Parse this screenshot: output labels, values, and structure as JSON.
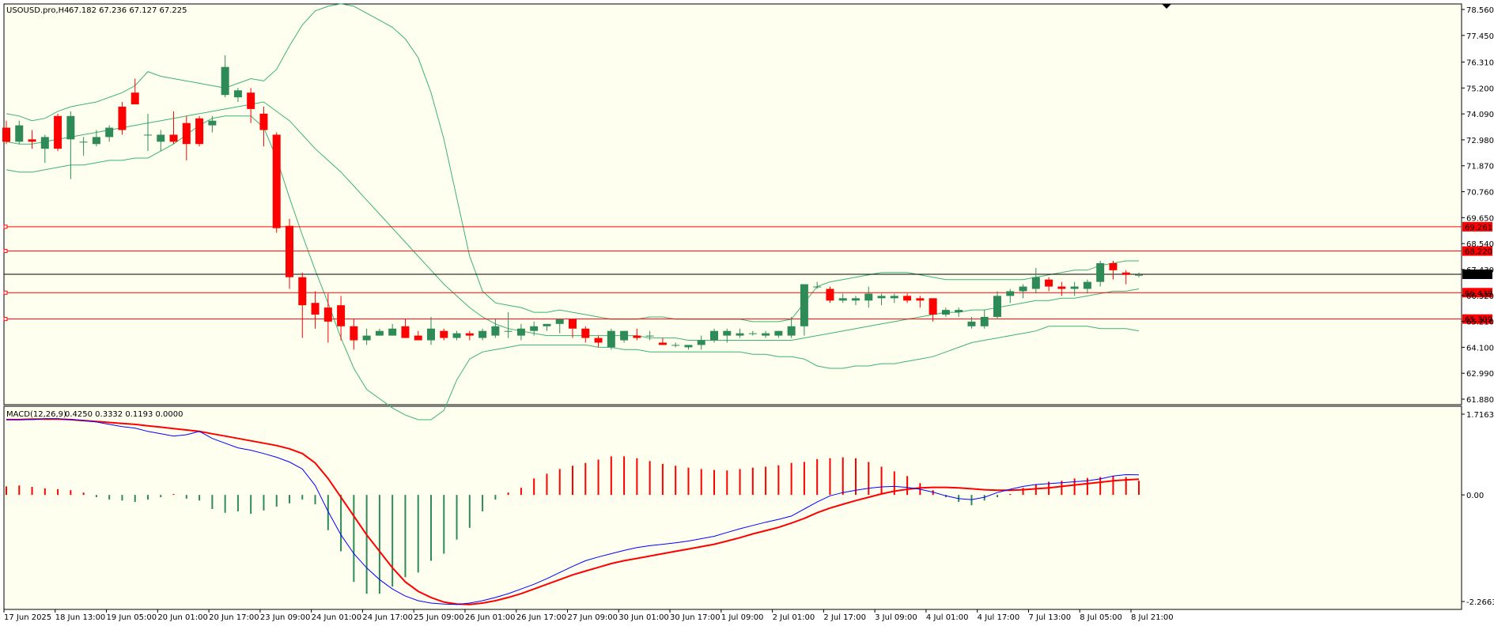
{
  "header": {
    "symbol": "USOUSD.pro,H4",
    "ohlc": "67.182 67.236 67.127 67.225"
  },
  "indicator": {
    "label": "MACD(12,26,9)",
    "values": "0.4250 0.3332 0.1193 0.0000"
  },
  "colors": {
    "background": "#fffff0",
    "bull": "#2e8b57",
    "bear": "#ff0000",
    "bands": "#3cb371",
    "macd_line": "#0000ff",
    "signal_line": "#ff0000",
    "level": "#ff0000",
    "price_line": "#000000"
  },
  "price_axis": {
    "ticks": [
      "78.560",
      "77.450",
      "76.310",
      "75.200",
      "74.090",
      "72.980",
      "71.870",
      "70.760",
      "69.650",
      "68.540",
      "67.430",
      "66.320",
      "65.210",
      "64.100",
      "62.990",
      "61.880"
    ],
    "range": [
      61.88,
      78.56
    ]
  },
  "macd_axis": {
    "ticks": [
      "1.7163",
      "0.00",
      "-2.2663"
    ],
    "range": [
      -2.2663,
      1.7163
    ]
  },
  "time_axis": {
    "labels": [
      "17 Jun 2025",
      "18 Jun 13:00",
      "19 Jun 05:00",
      "20 Jun 01:00",
      "20 Jun 17:00",
      "23 Jun 09:00",
      "24 Jun 01:00",
      "24 Jun 17:00",
      "25 Jun 09:00",
      "26 Jun 01:00",
      "26 Jun 17:00",
      "27 Jun 09:00",
      "30 Jun 01:00",
      "30 Jun 17:00",
      "1 Jul 09:00",
      "2 Jul 01:00",
      "2 Jul 17:00",
      "3 Jul 09:00",
      "4 Jul 01:00",
      "4 Jul 17:00",
      "7 Jul 13:00",
      "8 Jul 05:00",
      "8 Jul 21:00"
    ]
  },
  "levels": [
    {
      "value": 69.261,
      "label": "69.261"
    },
    {
      "value": 68.22,
      "label": "68.220"
    },
    {
      "value": 66.439,
      "label": "66.439"
    },
    {
      "value": 65.309,
      "label": "65.309"
    }
  ],
  "current_price": {
    "value": 67.225,
    "label": "67.225"
  },
  "chart_data": {
    "type": "candlestick",
    "title": "USOUSD.pro,H4",
    "candles": [
      [
        73.5,
        73.8,
        72.8,
        72.9
      ],
      [
        72.9,
        73.8,
        72.8,
        73.6
      ],
      [
        73.0,
        73.4,
        72.6,
        72.9
      ],
      [
        72.6,
        73.2,
        72.0,
        73.1
      ],
      [
        74.0,
        74.1,
        72.5,
        72.6
      ],
      [
        73.0,
        74.2,
        71.3,
        74.0
      ],
      [
        72.9,
        73.1,
        72.3,
        72.9
      ],
      [
        72.8,
        73.4,
        72.7,
        73.1
      ],
      [
        73.1,
        73.6,
        72.9,
        73.5
      ],
      [
        74.4,
        74.6,
        73.2,
        73.4
      ],
      [
        75.0,
        75.6,
        74.6,
        74.5
      ],
      [
        73.2,
        74.1,
        72.5,
        73.2
      ],
      [
        72.9,
        73.4,
        72.5,
        73.2
      ],
      [
        73.2,
        74.2,
        72.8,
        72.9
      ],
      [
        73.7,
        74.0,
        72.1,
        72.8
      ],
      [
        73.9,
        74.0,
        72.7,
        72.8
      ],
      [
        73.6,
        74.0,
        73.3,
        73.8
      ],
      [
        74.9,
        76.6,
        74.8,
        76.1
      ],
      [
        74.8,
        75.2,
        74.6,
        75.1
      ],
      [
        75.0,
        75.2,
        73.7,
        74.3
      ],
      [
        74.1,
        74.4,
        72.7,
        73.4
      ],
      [
        73.2,
        73.3,
        69.0,
        69.2
      ],
      [
        69.3,
        69.6,
        66.6,
        67.1
      ],
      [
        67.1,
        67.3,
        64.5,
        65.9
      ],
      [
        66.0,
        66.5,
        64.9,
        65.5
      ],
      [
        65.8,
        66.4,
        64.3,
        65.2
      ],
      [
        65.9,
        66.3,
        64.4,
        65.0
      ],
      [
        65.0,
        65.3,
        64.0,
        64.4
      ],
      [
        64.4,
        64.9,
        64.2,
        64.6
      ],
      [
        64.6,
        64.9,
        64.6,
        64.8
      ],
      [
        64.6,
        65.1,
        64.6,
        64.9
      ],
      [
        65.0,
        65.3,
        64.5,
        64.5
      ],
      [
        64.6,
        64.8,
        64.4,
        64.4
      ],
      [
        64.4,
        65.4,
        64.2,
        64.9
      ],
      [
        64.8,
        64.9,
        64.4,
        64.5
      ],
      [
        64.5,
        64.8,
        64.4,
        64.7
      ],
      [
        64.7,
        64.8,
        64.4,
        64.6
      ],
      [
        64.5,
        64.9,
        64.4,
        64.8
      ],
      [
        64.6,
        65.3,
        64.5,
        65.0
      ],
      [
        64.8,
        65.6,
        64.5,
        64.8
      ],
      [
        64.6,
        65.1,
        64.4,
        64.9
      ],
      [
        64.8,
        65.2,
        64.6,
        65.0
      ],
      [
        65.0,
        65.1,
        64.8,
        65.1
      ],
      [
        65.1,
        65.3,
        64.7,
        65.3
      ],
      [
        65.3,
        65.3,
        64.5,
        64.9
      ],
      [
        64.9,
        65.0,
        64.3,
        64.5
      ],
      [
        64.5,
        64.6,
        64.1,
        64.3
      ],
      [
        64.1,
        64.9,
        64.0,
        64.8
      ],
      [
        64.4,
        64.8,
        64.3,
        64.8
      ],
      [
        64.6,
        64.9,
        64.4,
        64.5
      ],
      [
        64.6,
        64.8,
        64.4,
        64.6
      ],
      [
        64.3,
        64.5,
        64.2,
        64.2
      ],
      [
        64.2,
        64.3,
        64.1,
        64.2
      ],
      [
        64.1,
        64.2,
        64.0,
        64.2
      ],
      [
        64.2,
        64.6,
        64.0,
        64.4
      ],
      [
        64.4,
        64.9,
        64.3,
        64.8
      ],
      [
        64.6,
        64.9,
        64.3,
        64.8
      ],
      [
        64.6,
        64.9,
        64.5,
        64.7
      ],
      [
        64.7,
        64.8,
        64.6,
        64.7
      ],
      [
        64.6,
        64.8,
        64.5,
        64.7
      ],
      [
        64.6,
        64.8,
        64.5,
        64.8
      ],
      [
        64.6,
        65.4,
        64.5,
        65.0
      ],
      [
        65.0,
        66.8,
        64.6,
        66.8
      ],
      [
        66.7,
        66.9,
        66.6,
        66.7
      ],
      [
        66.6,
        66.7,
        66.0,
        66.1
      ],
      [
        66.1,
        66.4,
        66.0,
        66.2
      ],
      [
        66.1,
        66.3,
        65.9,
        66.2
      ],
      [
        66.1,
        66.7,
        65.8,
        66.4
      ],
      [
        66.2,
        66.4,
        65.9,
        66.3
      ],
      [
        66.2,
        66.4,
        66.0,
        66.3
      ],
      [
        66.3,
        66.4,
        66.0,
        66.1
      ],
      [
        66.2,
        66.3,
        65.8,
        66.1
      ],
      [
        66.2,
        66.2,
        65.2,
        65.5
      ],
      [
        65.5,
        65.8,
        65.4,
        65.7
      ],
      [
        65.6,
        65.8,
        65.4,
        65.7
      ],
      [
        65.0,
        65.4,
        64.9,
        65.2
      ],
      [
        65.0,
        65.7,
        64.9,
        65.4
      ],
      [
        65.4,
        66.5,
        65.3,
        66.3
      ],
      [
        66.3,
        66.6,
        66.0,
        66.5
      ],
      [
        66.5,
        66.8,
        66.2,
        66.7
      ],
      [
        66.6,
        67.5,
        66.4,
        67.1
      ],
      [
        67.0,
        67.1,
        66.5,
        66.7
      ],
      [
        66.7,
        66.9,
        66.3,
        66.6
      ],
      [
        66.6,
        66.9,
        66.3,
        66.7
      ],
      [
        66.6,
        67.0,
        66.4,
        66.9
      ],
      [
        66.9,
        67.8,
        66.7,
        67.7
      ],
      [
        67.7,
        67.8,
        67.0,
        67.4
      ],
      [
        67.3,
        67.4,
        66.8,
        67.2
      ],
      [
        67.2,
        67.3,
        67.1,
        67.2
      ]
    ],
    "bollinger": {
      "upper": [
        74.1,
        74.0,
        73.8,
        73.9,
        74.2,
        74.4,
        74.5,
        74.6,
        74.8,
        75.0,
        75.3,
        75.9,
        75.7,
        75.6,
        75.5,
        75.4,
        75.3,
        75.2,
        75.4,
        75.6,
        75.5,
        76.0,
        77.0,
        77.9,
        78.5,
        78.7,
        78.8,
        78.7,
        78.4,
        78.1,
        77.8,
        77.3,
        76.5,
        75.0,
        73.0,
        70.5,
        68.0,
        66.5,
        66.0,
        65.9,
        65.8,
        65.6,
        65.6,
        65.7,
        65.6,
        65.5,
        65.4,
        65.3,
        65.3,
        65.3,
        65.4,
        65.4,
        65.3,
        65.3,
        65.3,
        65.3,
        65.3,
        65.3,
        65.2,
        65.2,
        65.2,
        65.3,
        66.0,
        66.7,
        66.9,
        67.0,
        67.1,
        67.2,
        67.3,
        67.3,
        67.3,
        67.2,
        67.1,
        67.0,
        67.0,
        67.0,
        67.0,
        67.0,
        67.0,
        67.0,
        67.1,
        67.2,
        67.3,
        67.4,
        67.4,
        67.6,
        67.7,
        67.8,
        67.8
      ],
      "middle": [
        72.9,
        72.8,
        72.8,
        72.9,
        73.0,
        73.1,
        73.2,
        73.3,
        73.4,
        73.5,
        73.6,
        73.7,
        73.8,
        73.9,
        74.0,
        74.1,
        74.2,
        74.3,
        74.4,
        74.5,
        74.6,
        74.2,
        73.8,
        73.2,
        72.6,
        72.1,
        71.6,
        71.0,
        70.4,
        69.8,
        69.2,
        68.6,
        68.0,
        67.4,
        66.8,
        66.3,
        65.8,
        65.4,
        65.1,
        64.9,
        64.8,
        64.7,
        64.6,
        64.6,
        64.6,
        64.6,
        64.6,
        64.6,
        64.6,
        64.6,
        64.5,
        64.5,
        64.5,
        64.4,
        64.4,
        64.4,
        64.4,
        64.4,
        64.4,
        64.4,
        64.4,
        64.4,
        64.5,
        64.6,
        64.7,
        64.8,
        64.9,
        65.0,
        65.1,
        65.2,
        65.3,
        65.4,
        65.5,
        65.6,
        65.6,
        65.7,
        65.7,
        65.8,
        65.9,
        66.0,
        66.1,
        66.1,
        66.2,
        66.2,
        66.3,
        66.4,
        66.5,
        66.5,
        66.6
      ],
      "lower": [
        71.7,
        71.6,
        71.6,
        71.7,
        71.8,
        71.9,
        71.9,
        72.0,
        72.1,
        72.1,
        72.2,
        72.2,
        72.5,
        72.8,
        73.2,
        73.6,
        73.9,
        74.0,
        74.0,
        74.0,
        73.5,
        72.2,
        70.5,
        68.9,
        67.4,
        66.0,
        64.5,
        63.2,
        62.3,
        61.9,
        61.5,
        61.2,
        61.0,
        61.0,
        61.4,
        62.7,
        63.6,
        63.9,
        64.0,
        64.1,
        64.2,
        64.2,
        64.2,
        64.2,
        64.2,
        64.2,
        64.1,
        64.1,
        64.0,
        64.0,
        63.9,
        63.9,
        63.9,
        63.9,
        63.9,
        63.9,
        63.9,
        63.9,
        63.8,
        63.8,
        63.7,
        63.7,
        63.6,
        63.3,
        63.2,
        63.2,
        63.3,
        63.3,
        63.4,
        63.4,
        63.5,
        63.6,
        63.7,
        63.9,
        64.1,
        64.3,
        64.4,
        64.5,
        64.6,
        64.7,
        64.8,
        65.0,
        65.0,
        65.0,
        65.0,
        64.9,
        64.9,
        64.9,
        64.8
      ]
    },
    "macd": {
      "histogram": [
        0.18,
        0.2,
        0.17,
        0.14,
        0.12,
        0.1,
        0.05,
        -0.05,
        -0.1,
        -0.12,
        -0.15,
        -0.1,
        -0.05,
        0.02,
        -0.08,
        -0.12,
        -0.3,
        -0.38,
        -0.35,
        -0.4,
        -0.33,
        -0.25,
        -0.18,
        -0.1,
        -0.2,
        -0.75,
        -1.2,
        -1.85,
        -2.1,
        -2.1,
        -1.95,
        -1.75,
        -1.65,
        -1.4,
        -1.25,
        -0.95,
        -0.7,
        -0.35,
        -0.1,
        0.05,
        0.15,
        0.35,
        0.45,
        0.55,
        0.62,
        0.68,
        0.75,
        0.82,
        0.82,
        0.78,
        0.72,
        0.66,
        0.62,
        0.58,
        0.55,
        0.53,
        0.52,
        0.55,
        0.58,
        0.6,
        0.63,
        0.68,
        0.7,
        0.76,
        0.78,
        0.8,
        0.78,
        0.7,
        0.6,
        0.5,
        0.4,
        0.25,
        0.1,
        -0.05,
        -0.15,
        -0.22,
        -0.12,
        -0.05,
        0.02,
        0.15,
        0.22,
        0.28,
        0.3,
        0.35,
        0.36,
        0.38,
        0.4,
        0.38,
        0.3
      ],
      "macd_line": [
        1.6,
        1.6,
        1.6,
        1.62,
        1.62,
        1.6,
        1.58,
        1.55,
        1.5,
        1.45,
        1.42,
        1.35,
        1.3,
        1.25,
        1.28,
        1.35,
        1.2,
        1.1,
        1.0,
        0.95,
        0.88,
        0.8,
        0.7,
        0.55,
        0.2,
        -0.35,
        -0.85,
        -1.25,
        -1.55,
        -1.8,
        -2.0,
        -2.15,
        -2.25,
        -2.3,
        -2.32,
        -2.33,
        -2.3,
        -2.25,
        -2.18,
        -2.1,
        -2.0,
        -1.9,
        -1.78,
        -1.65,
        -1.52,
        -1.4,
        -1.32,
        -1.25,
        -1.18,
        -1.12,
        -1.08,
        -1.05,
        -1.02,
        -0.98,
        -0.93,
        -0.88,
        -0.8,
        -0.72,
        -0.65,
        -0.58,
        -0.52,
        -0.45,
        -0.3,
        -0.15,
        -0.02,
        0.05,
        0.1,
        0.14,
        0.17,
        0.18,
        0.16,
        0.12,
        0.06,
        -0.02,
        -0.08,
        -0.1,
        -0.05,
        0.05,
        0.12,
        0.18,
        0.22,
        0.24,
        0.26,
        0.28,
        0.3,
        0.34,
        0.4,
        0.43,
        0.425
      ],
      "signal_line": [
        1.6,
        1.6,
        1.61,
        1.61,
        1.61,
        1.6,
        1.58,
        1.56,
        1.54,
        1.52,
        1.5,
        1.47,
        1.44,
        1.41,
        1.38,
        1.35,
        1.3,
        1.25,
        1.2,
        1.15,
        1.1,
        1.05,
        0.98,
        0.88,
        0.68,
        0.35,
        -0.05,
        -0.45,
        -0.85,
        -1.2,
        -1.55,
        -1.85,
        -2.05,
        -2.18,
        -2.28,
        -2.32,
        -2.33,
        -2.3,
        -2.25,
        -2.18,
        -2.1,
        -2.0,
        -1.9,
        -1.8,
        -1.7,
        -1.62,
        -1.54,
        -1.46,
        -1.4,
        -1.35,
        -1.3,
        -1.25,
        -1.2,
        -1.15,
        -1.1,
        -1.05,
        -0.98,
        -0.91,
        -0.83,
        -0.76,
        -0.69,
        -0.6,
        -0.5,
        -0.38,
        -0.28,
        -0.2,
        -0.12,
        -0.05,
        0.02,
        0.08,
        0.12,
        0.15,
        0.16,
        0.16,
        0.15,
        0.13,
        0.11,
        0.1,
        0.1,
        0.11,
        0.13,
        0.15,
        0.18,
        0.21,
        0.24,
        0.27,
        0.3,
        0.32,
        0.333
      ]
    }
  }
}
